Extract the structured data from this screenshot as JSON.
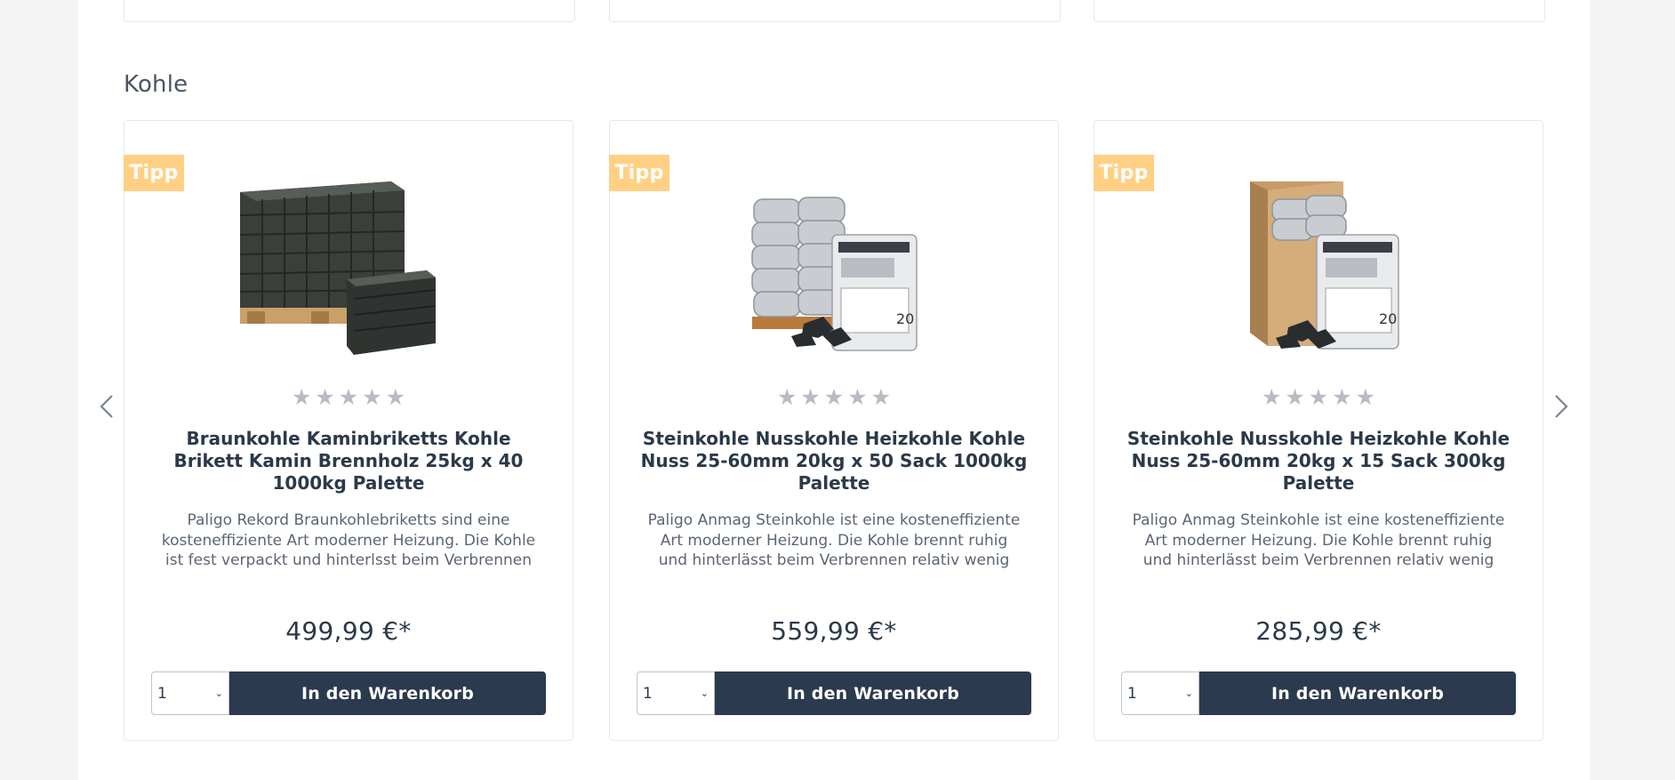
{
  "section": {
    "title": "Kohle"
  },
  "carousel": {
    "prev_icon": "chevron-left-icon",
    "next_icon": "chevron-right-icon"
  },
  "products": [
    {
      "badge": "Tipp",
      "image_icon": "briquette-pallet-image",
      "rating": 0,
      "title": "Braunkohle Kaminbriketts Kohle Brikett Kamin Brennholz 25kg x 40 1000kg Palette",
      "description": "Paligo Rekord Braunkohlebriketts sind eine kosteneffiziente Art moderner Heizung. Die Kohle ist fest verpackt und hinterlsst beim Verbrennen relativ...",
      "price": "499,99 €*",
      "qty": "1",
      "button": "In den Warenkorb"
    },
    {
      "badge": "Tipp",
      "image_icon": "coal-sacks-pallet-image",
      "rating": 0,
      "title": "Steinkohle Nusskohle Heizkohle Kohle Nuss 25-60mm 20kg x 50 Sack 1000kg Palette",
      "description": "Paligo Anmag Steinkohle ist eine kosteneffiziente Art moderner Heizung. Die Kohle brennt ruhig und hinterlässt beim Verbrennen relativ wenig Asche....",
      "price": "559,99 €*",
      "qty": "1",
      "button": "In den Warenkorb"
    },
    {
      "badge": "Tipp",
      "image_icon": "coal-sacks-box-image",
      "rating": 0,
      "title": "Steinkohle Nusskohle Heizkohle Kohle Nuss 25-60mm 20kg x 15 Sack 300kg Palette",
      "description": "Paligo Anmag Steinkohle ist eine kosteneffiziente Art moderner Heizung. Die Kohle brennt ruhig und hinterlässt beim Verbrennen relativ wenig Asche....",
      "price": "285,99 €*",
      "qty": "1",
      "button": "In den Warenkorb"
    }
  ],
  "colors": {
    "badge": "#ffd083",
    "button": "#2b3a4e",
    "star": "#b7bcc4"
  }
}
